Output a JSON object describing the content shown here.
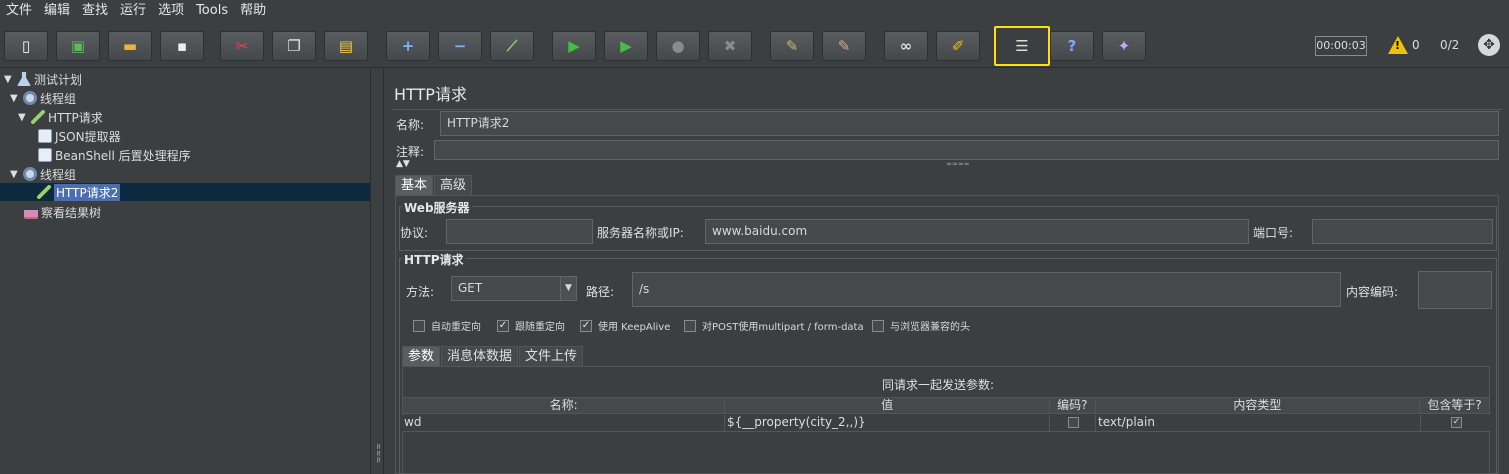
{
  "menu": [
    "文件",
    "编辑",
    "查找",
    "运行",
    "选项",
    "Tools",
    "帮助"
  ],
  "toolbar": {
    "buttons": [
      {
        "name": "new-button",
        "glyph": "▯",
        "color": "#f3f3f3"
      },
      {
        "name": "templates-button",
        "glyph": "▣",
        "color": "#5fb85f"
      },
      {
        "name": "open-button",
        "glyph": "▬",
        "color": "#e7b73c"
      },
      {
        "name": "save-button",
        "glyph": "▪",
        "color": "#ededed"
      },
      {
        "name": "cut-button",
        "glyph": "✂",
        "color": "#e04a4a"
      },
      {
        "name": "copy-button",
        "glyph": "❐",
        "color": "#e4e4e4"
      },
      {
        "name": "paste-button",
        "glyph": "▤",
        "color": "#f1c94f"
      },
      {
        "name": "expand-button",
        "glyph": "+",
        "color": "#7fb3ff"
      },
      {
        "name": "collapse-button",
        "glyph": "−",
        "color": "#7fb3ff"
      },
      {
        "name": "toggle-button",
        "glyph": "⟋",
        "color": "#8fd06a"
      },
      {
        "name": "start-button",
        "glyph": "▶",
        "color": "#43c043"
      },
      {
        "name": "start-no-pause-button",
        "glyph": "▶",
        "color": "#43c043"
      },
      {
        "name": "stop-button",
        "glyph": "●",
        "color": "#8a8a8a"
      },
      {
        "name": "shutdown-button",
        "glyph": "✖",
        "color": "#8a8a8a"
      },
      {
        "name": "clear-button",
        "glyph": "✎",
        "color": "#c9b37a"
      },
      {
        "name": "clear-all-button",
        "glyph": "✎",
        "color": "#c9b37a"
      },
      {
        "name": "search-button",
        "glyph": "∞",
        "color": "#dddddd"
      },
      {
        "name": "reset-search-button",
        "glyph": "✐",
        "color": "#f0c000"
      },
      {
        "name": "function-helper-button",
        "glyph": "☰",
        "color": "#dddddd"
      },
      {
        "name": "help-button",
        "glyph": "?",
        "color": "#7fa8ff"
      },
      {
        "name": "remote-button",
        "glyph": "✦",
        "color": "#c7a6ff"
      }
    ],
    "timer": "00:00:03",
    "warnings": "0",
    "threads": "0/2"
  },
  "tree": {
    "items": [
      {
        "label": "测试计划",
        "icon": "flask"
      },
      {
        "label": "线程组",
        "icon": "gear"
      },
      {
        "label": "HTTP请求",
        "icon": "pen"
      },
      {
        "label": "JSON提取器",
        "icon": "doc"
      },
      {
        "label": "BeanShell 后置处理程序",
        "icon": "doc"
      },
      {
        "label": "线程组",
        "icon": "gear"
      },
      {
        "label": "HTTP请求2",
        "icon": "pen"
      },
      {
        "label": "察看结果树",
        "icon": "chart"
      }
    ]
  },
  "panel": {
    "title": "HTTP请求",
    "name_label": "名称:",
    "name_value": "HTTP请求2",
    "comment_label": "注释:",
    "tabs": [
      "基本",
      "高级"
    ],
    "web_server": {
      "title": "Web服务器",
      "protocol_label": "协议:",
      "protocol_value": "",
      "server_label": "服务器名称或IP:",
      "server_value": "www.baidu.com",
      "port_label": "端口号:",
      "port_value": ""
    },
    "http_request": {
      "title": "HTTP请求",
      "method_label": "方法:",
      "method_value": "GET",
      "path_label": "路径:",
      "path_value": "/s",
      "encoding_label": "内容编码:",
      "encoding_value": "",
      "options": [
        {
          "label": "自动重定向",
          "checked": false
        },
        {
          "label": "跟随重定向",
          "checked": true
        },
        {
          "label": "使用 KeepAlive",
          "checked": true
        },
        {
          "label": "对POST使用multipart / form-data",
          "checked": false
        },
        {
          "label": "与浏览器兼容的头",
          "checked": false
        }
      ]
    },
    "sub_tabs": [
      "参数",
      "消息体数据",
      "文件上传"
    ],
    "params": {
      "caption": "同请求一起发送参数:",
      "columns": [
        "名称:",
        "值",
        "编码?",
        "内容类型",
        "包含等于?"
      ],
      "rows": [
        {
          "name": "wd",
          "value": "${__property(city_2,,)}",
          "encode": false,
          "content_type": "text/plain",
          "include_equals": true
        }
      ]
    }
  }
}
